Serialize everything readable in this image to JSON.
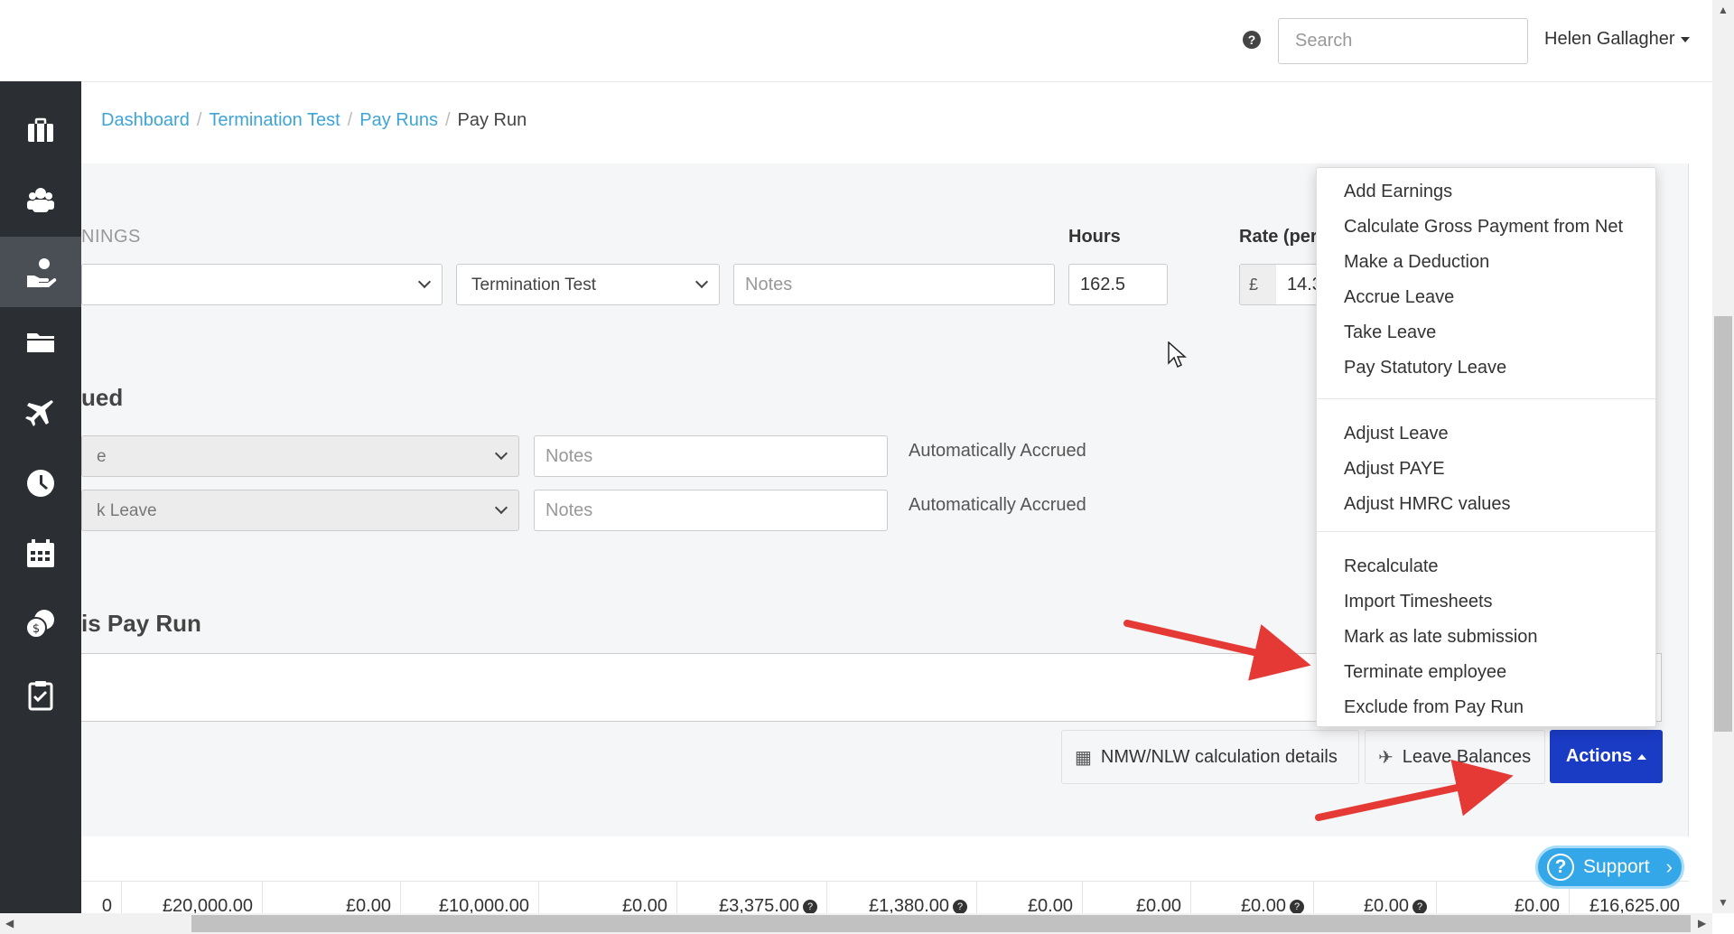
{
  "topbar": {
    "help_icon": "question-circle-icon",
    "search_placeholder": "Search",
    "user_name": "Helen Gallagher"
  },
  "sidebar": {
    "items": [
      {
        "icon": "briefcase-icon"
      },
      {
        "icon": "employees-icon"
      },
      {
        "icon": "payroll-hand-icon",
        "active": true
      },
      {
        "icon": "folder-icon"
      },
      {
        "icon": "airplane-icon"
      },
      {
        "icon": "clock-icon"
      },
      {
        "icon": "calendar-icon"
      },
      {
        "icon": "coins-icon"
      },
      {
        "icon": "clipboard-check-icon"
      }
    ]
  },
  "breadcrumb": {
    "items": [
      "Dashboard",
      "Termination Test",
      "Pay Runs"
    ],
    "current": "Pay Run"
  },
  "earnings": {
    "section_label": "NINGS",
    "hours_label": "Hours",
    "rate_label": "Rate (per",
    "employee_select": "Termination Test",
    "notes_placeholder": "Notes",
    "hours_value": "162.5",
    "currency_symbol": "£",
    "rate_value": "14.3"
  },
  "accrued": {
    "title": "ued",
    "rows": [
      {
        "select": "e",
        "notes_placeholder": "Notes",
        "status": "Automatically Accrued"
      },
      {
        "select": "k Leave",
        "notes_placeholder": "Notes",
        "status": "Automatically Accrued"
      }
    ]
  },
  "notes_section": {
    "title": "is Pay Run"
  },
  "buttons": {
    "nmw": "NMW/NLW calculation details",
    "leave_balances": "Leave Balances",
    "actions": "Actions"
  },
  "actions_menu": {
    "group1": [
      "Add Earnings",
      "Calculate Gross Payment from Net",
      "Make a Deduction",
      "Accrue Leave",
      "Take Leave",
      "Pay Statutory Leave"
    ],
    "group2": [
      "Adjust Leave",
      "Adjust PAYE",
      "Adjust HMRC values"
    ],
    "group3": [
      "Recalculate",
      "Import Timesheets",
      "Mark as late submission",
      "Terminate employee",
      "Exclude from Pay Run"
    ]
  },
  "table_row": {
    "cells": [
      "0",
      "£20,000.00",
      "£0.00",
      "£10,000.00",
      "£0.00",
      "£3,375.00",
      "£1,380.00",
      "£0.00",
      "£0.00",
      "£0.00",
      "£0.00",
      "£0.00",
      "£16,625.00"
    ]
  },
  "support": {
    "label": "Support"
  },
  "colors": {
    "sidebar_bg": "#2b2f33",
    "link": "#3ea4d6",
    "primary_button": "#1a3bc4",
    "support": "#33a7e8",
    "annotation_arrow": "#e53935"
  }
}
